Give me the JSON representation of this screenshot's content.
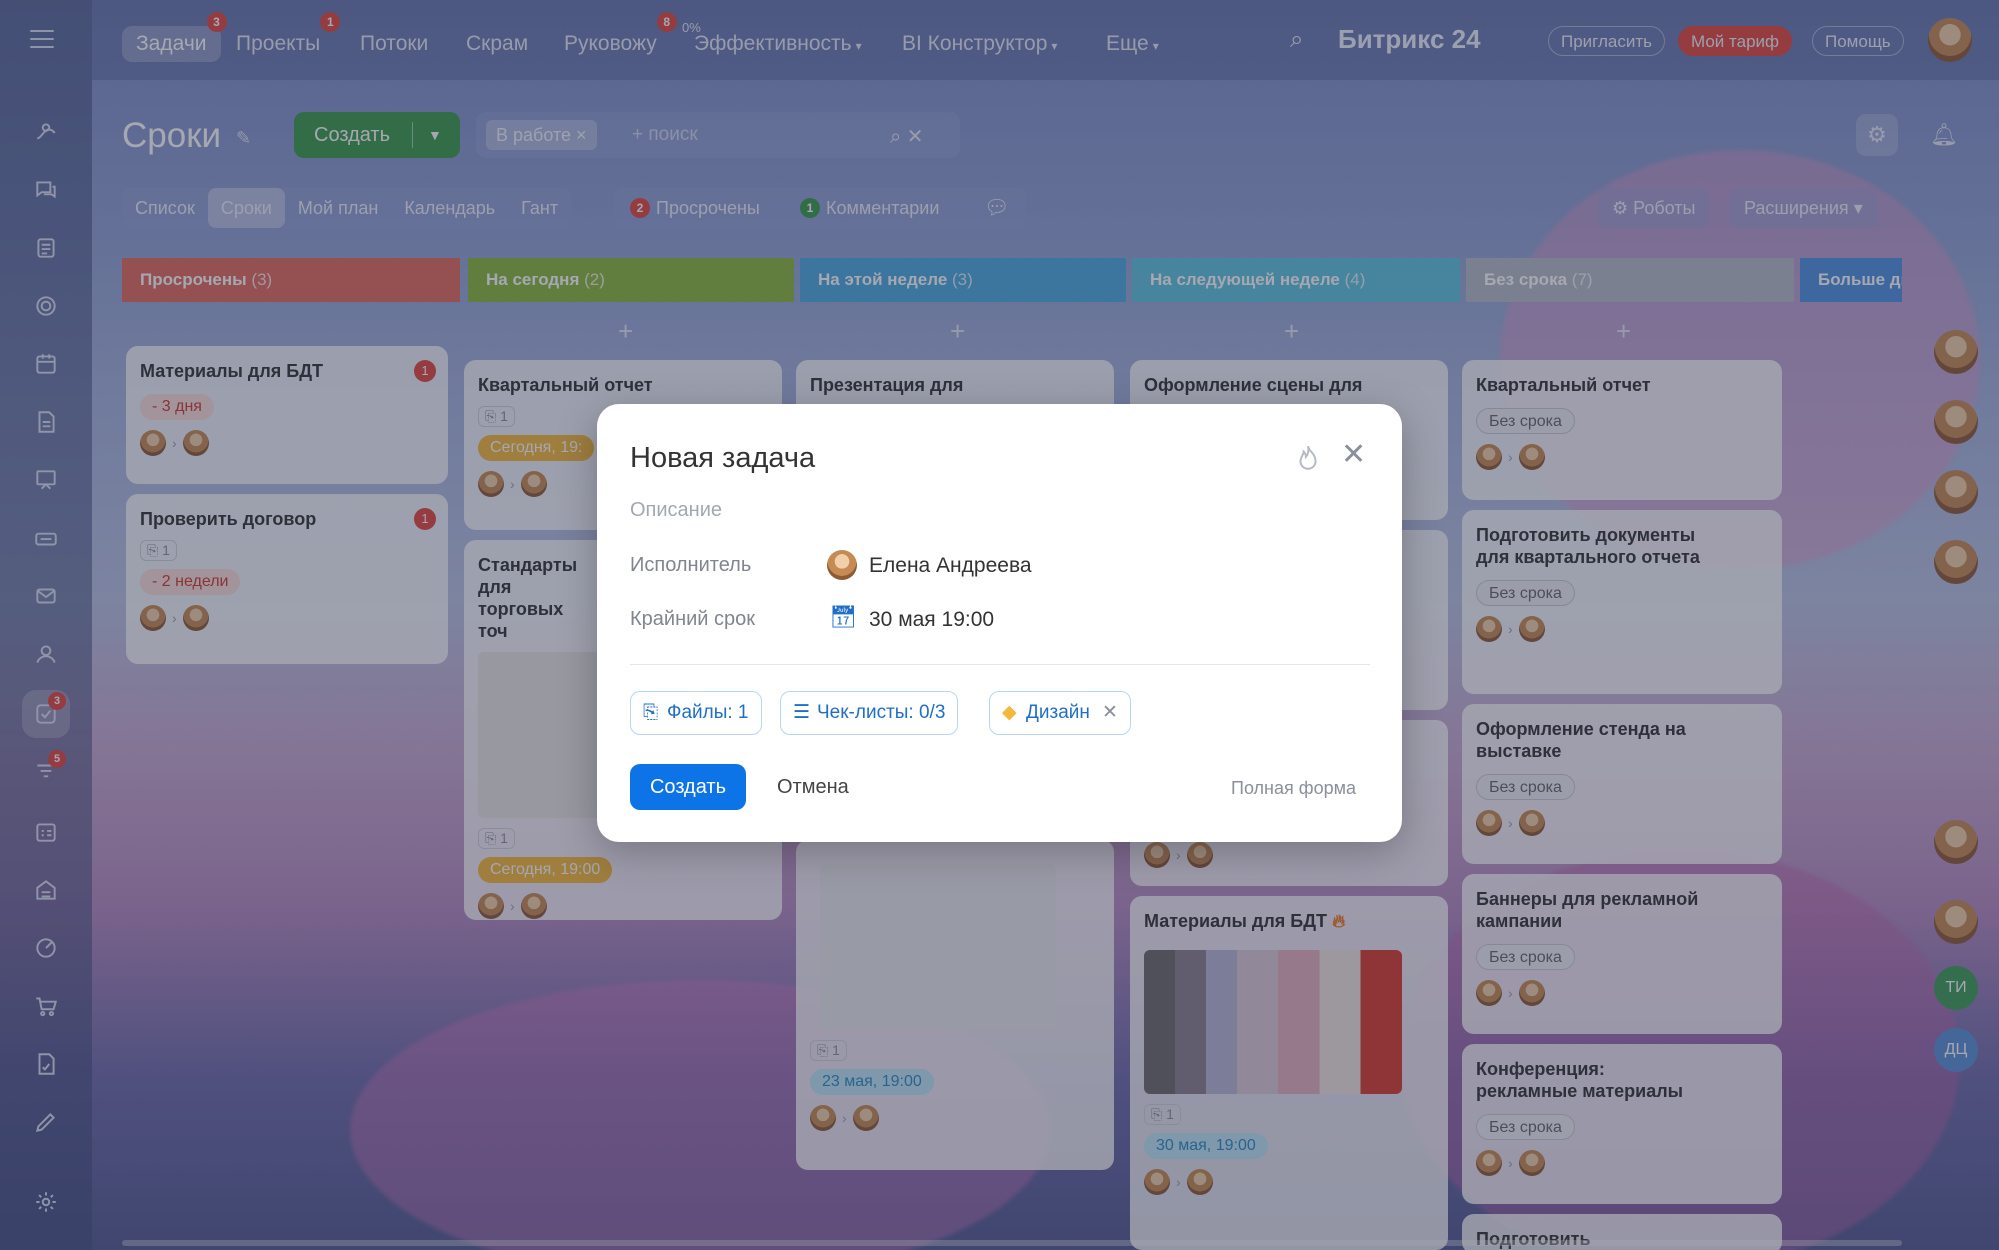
{
  "nav": {
    "items": [
      {
        "label": "Задачи",
        "badge": "3",
        "active": true
      },
      {
        "label": "Проекты",
        "badge": "1"
      },
      {
        "label": "Потоки"
      },
      {
        "label": "Скрам"
      },
      {
        "label": "Руковожу",
        "badge": "8"
      },
      {
        "label": "Эффективность",
        "sup": "0%",
        "chevron": true
      },
      {
        "label": "BI Конструктор",
        "chevron": true
      },
      {
        "label": "Еще",
        "chevron": true
      }
    ],
    "brand": "Битрикс 24",
    "invite": "Пригласить",
    "tariff": "Мой тариф",
    "help": "Помощь"
  },
  "sidebar_badges": {
    "tasks": "3",
    "filters": "5"
  },
  "page": {
    "title": "Сроки",
    "create": "Создать",
    "search_chip": "В работе",
    "search_placeholder": "+ поиск",
    "views": [
      "Список",
      "Сроки",
      "Мой план",
      "Календарь",
      "Гант"
    ],
    "counters": [
      {
        "n": "2",
        "label": "Просрочены",
        "color": "#e2483c"
      },
      {
        "n": "1",
        "label": "Комментарии",
        "color": "#3a9b4b"
      }
    ],
    "robots": "Роботы",
    "extensions": "Расширения"
  },
  "columns": [
    {
      "name": "Просрочены",
      "count": "(3)",
      "color": "#e36a5c"
    },
    {
      "name": "На сегодня",
      "count": "(2)",
      "color": "#8cb93a"
    },
    {
      "name": "На этой неделе",
      "count": "(3)",
      "color": "#4aa9dc"
    },
    {
      "name": "На следующей неделе",
      "count": "(4)",
      "color": "#5ec3dd"
    },
    {
      "name": "Без срока",
      "count": "(7)",
      "color": "#b7bcc7"
    },
    {
      "name": "Больше дв",
      "count": "",
      "color": "#4f8fe0"
    }
  ],
  "cards": {
    "c1": {
      "title": "Материалы для БДТ",
      "badge": "1",
      "tag": "- 3 дня"
    },
    "c2": {
      "title": "Проверить договор",
      "badge": "1",
      "att": "1",
      "tag": "- 2 недели"
    },
    "c3": {
      "title": "Квартальный отчет",
      "att": "1",
      "tag": "Сегодня, 19:"
    },
    "c4": {
      "title": "Стандарты для торговых точ",
      "att": "1",
      "tag": "Сегодня, 19:00"
    },
    "c5": {
      "title": "Презентация для"
    },
    "c6": {
      "att": "1",
      "tag": "23 мая, 19:00"
    },
    "c7": {
      "title": "Оформление сцены для"
    },
    "c8": {
      "title": "Материалы для БДТ",
      "att": "1",
      "tag": "30 мая, 19:00"
    },
    "c9": {
      "title": "Квартальный отчет",
      "tag": "Без срока"
    },
    "c10": {
      "title": "Подготовить документы для квартального отчета",
      "tag": "Без срока"
    },
    "c11": {
      "title": "Оформление стенда на выставке",
      "tag": "Без срока"
    },
    "c12": {
      "title": "Баннеры для рекламной кампании",
      "tag": "Без срока"
    },
    "c13": {
      "title": "Конференция: рекламные материалы",
      "tag": "Без срока"
    },
    "c14": {
      "title": "Подготовить"
    }
  },
  "right_sidebar": {
    "initials1": "ТИ",
    "initials2": "ДЦ"
  },
  "modal": {
    "title": "Новая задача",
    "description_placeholder": "Описание",
    "assignee_label": "Исполнитель",
    "assignee": "Елена Андреева",
    "deadline_label": "Крайний срок",
    "deadline": "30 мая 19:00",
    "files": "Файлы: 1",
    "checklists": "Чек-листы: 0/3",
    "tag": "Дизайн",
    "create": "Создать",
    "cancel": "Отмена",
    "full_form": "Полная форма"
  }
}
